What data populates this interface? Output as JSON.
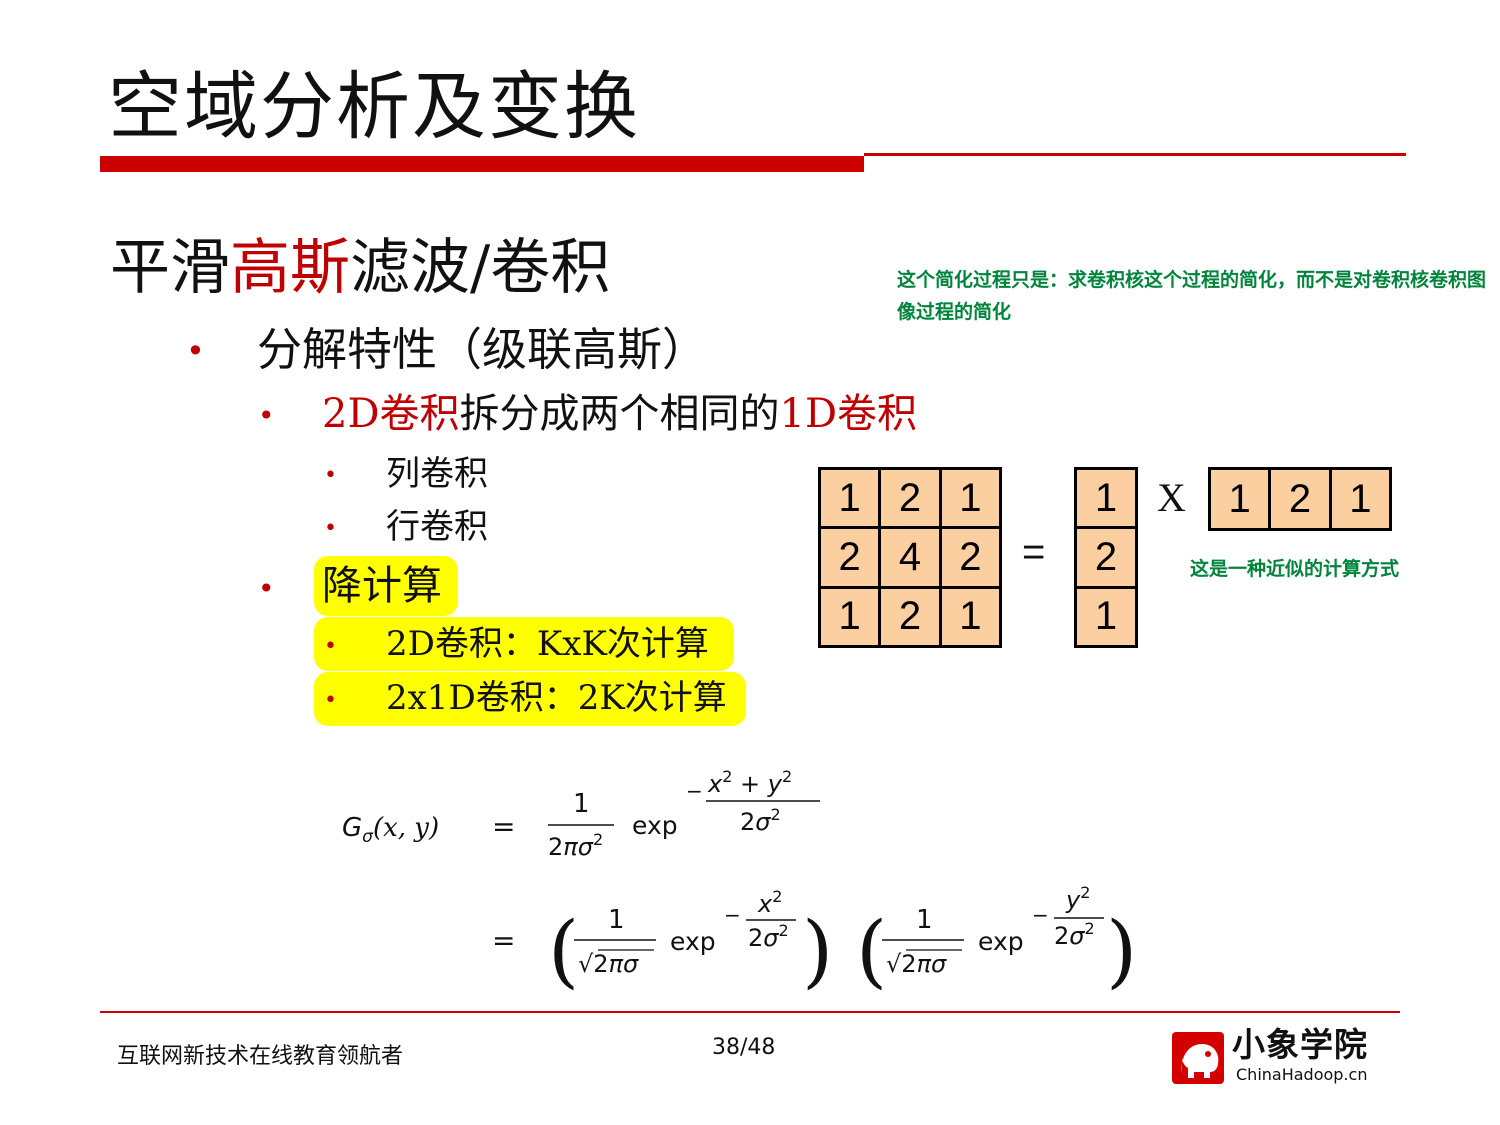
{
  "title": "空域分析及变换",
  "heading": {
    "part1": "平滑",
    "part2_red": "高斯",
    "part3": "滤波/卷积"
  },
  "note_top": "这个简化过程只是：求卷积核这个过程的简化，而不是对卷积核卷积图像过程的简化",
  "note_right": "这是一种近似的计算方式",
  "bullet_symbol": "•",
  "bullets": {
    "level1": "分解特性（级联高斯）",
    "level2_red_a": "2D卷积",
    "level2_mid": "拆分成两个相同的",
    "level2_red_b": "1D卷积",
    "sub1": "列卷积",
    "sub2": "行卷积",
    "reduce": "降计算",
    "reduce_item1": "2D卷积：KxK次计算",
    "reduce_item2": "2x1D卷积：2K次计算"
  },
  "matrix": {
    "kernel_2d": [
      "1",
      "2",
      "1",
      "2",
      "4",
      "2",
      "1",
      "2",
      "1"
    ],
    "equals": "=",
    "column": [
      "1",
      "2",
      "1"
    ],
    "times": "X",
    "row": [
      "1",
      "2",
      "1"
    ]
  },
  "formula": {
    "lhs": "Gσ(x, y)",
    "eq": "=",
    "one": "1",
    "two_pi_sigma_sq": "2πσ2",
    "exp": "exp",
    "minus": "−",
    "x2_plus_y2": "x2 + y2",
    "two_sigma_sq": "2σ2",
    "sqrt_2pi_sigma": "√2πσ",
    "x2": "x2",
    "y2": "y2"
  },
  "colors": {
    "accent_red": "#cc0000",
    "note_green": "#00843c",
    "highlight": "#ffff00",
    "cell_fill": "#fbcf9f"
  },
  "footer": {
    "left": "互联网新技术在线教育领航者",
    "page": "38/48",
    "logo_name": "小象学院",
    "logo_domain": "ChinaHadoop.cn",
    "logo_icon": "elephant-icon"
  }
}
